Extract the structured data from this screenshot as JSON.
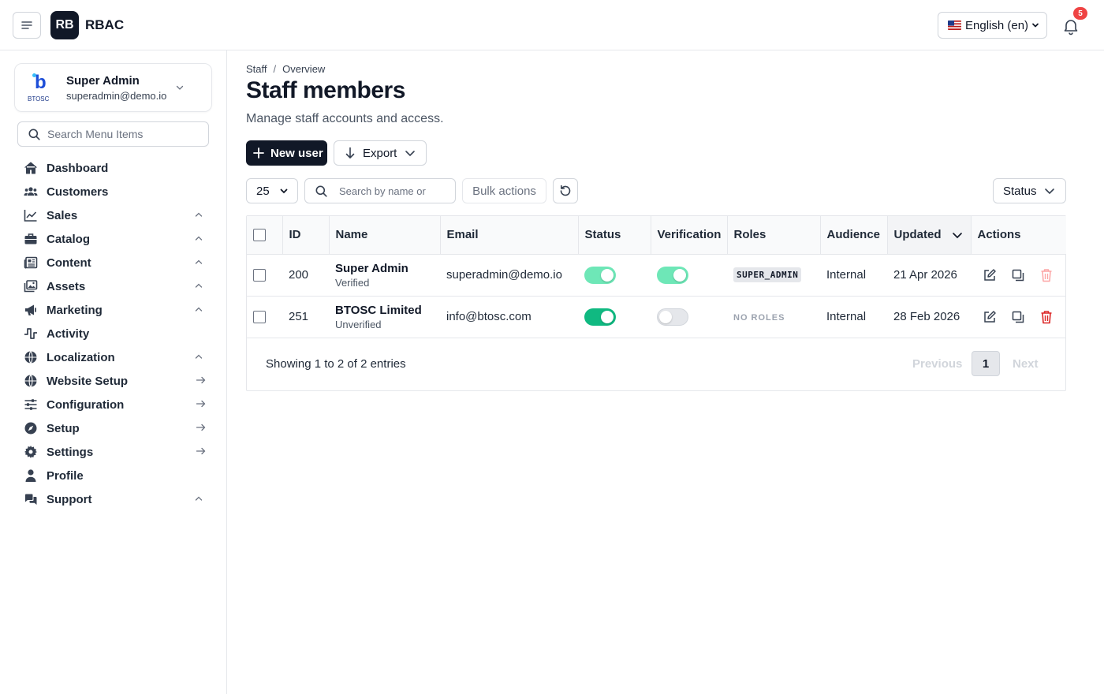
{
  "header": {
    "logo_text": "RB",
    "app_title": "RBAC",
    "language": "English (en)",
    "notification_count": "5"
  },
  "sidebar": {
    "user": {
      "logo_text": "BTOSC",
      "name": "Super Admin",
      "email": "superadmin@demo.io"
    },
    "search_placeholder": "Search Menu Items",
    "items": [
      {
        "label": "Dashboard",
        "icon": "home-icon",
        "trail": "none"
      },
      {
        "label": "Customers",
        "icon": "users-icon",
        "trail": "none"
      },
      {
        "label": "Sales",
        "icon": "chart-line-icon",
        "trail": "chevron"
      },
      {
        "label": "Catalog",
        "icon": "briefcase-icon",
        "trail": "chevron"
      },
      {
        "label": "Content",
        "icon": "newspaper-icon",
        "trail": "chevron"
      },
      {
        "label": "Assets",
        "icon": "images-icon",
        "trail": "chevron"
      },
      {
        "label": "Marketing",
        "icon": "megaphone-icon",
        "trail": "chevron"
      },
      {
        "label": "Activity",
        "icon": "pulse-icon",
        "trail": "none"
      },
      {
        "label": "Localization",
        "icon": "globe-icon",
        "trail": "chevron"
      },
      {
        "label": "Website Setup",
        "icon": "globe-icon",
        "trail": "arrow"
      },
      {
        "label": "Configuration",
        "icon": "sliders-icon",
        "trail": "arrow"
      },
      {
        "label": "Setup",
        "icon": "compass-icon",
        "trail": "arrow"
      },
      {
        "label": "Settings",
        "icon": "gear-icon",
        "trail": "arrow"
      },
      {
        "label": "Profile",
        "icon": "user-icon",
        "trail": "none"
      },
      {
        "label": "Support",
        "icon": "chat-icon",
        "trail": "chevron"
      }
    ]
  },
  "main": {
    "breadcrumb": [
      "Staff",
      "Overview"
    ],
    "breadcrumb_sep": "/",
    "title": "Staff members",
    "subtitle": "Manage staff accounts and access.",
    "new_user_label": "New user",
    "export_label": "Export",
    "per_page": "25",
    "search_placeholder": "Search by name or email",
    "bulk_actions_label": "Bulk actions",
    "status_filter_label": "Status",
    "table": {
      "columns": [
        "ID",
        "Name",
        "Email",
        "Status",
        "Verification",
        "Roles",
        "Audience",
        "Updated",
        "Actions"
      ],
      "rows": [
        {
          "id": "200",
          "name": "Super Admin",
          "verified": "Verified",
          "email": "superadmin@demo.io",
          "status": "on",
          "verification": "on",
          "role": "SUPER_ADMIN",
          "audience": "Internal",
          "updated": "21 Apr 2026"
        },
        {
          "id": "251",
          "name": "BTOSC Limited",
          "verified": "Unverified",
          "email": "info@btosc.com",
          "status": "on",
          "verification": "off",
          "role": "NO ROLES",
          "audience": "Internal",
          "updated": "28 Feb 2026"
        }
      ]
    },
    "pagination": {
      "showing": "Showing 1 to 2 of 2 entries",
      "previous": "Previous",
      "page": "1",
      "next": "Next"
    }
  },
  "colors": {
    "primary": "#111827",
    "toggle_on": "#10b981",
    "toggle_on_light": "#6ee7b7",
    "danger": "#dc2626",
    "badge": "#ef4444"
  }
}
